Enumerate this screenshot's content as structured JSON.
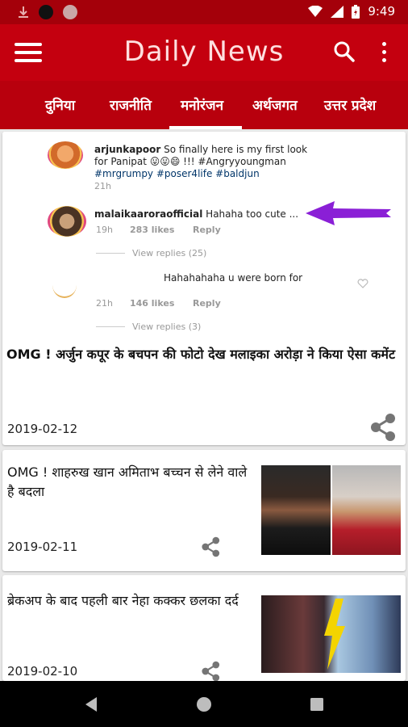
{
  "status": {
    "time": "9:49"
  },
  "app": {
    "title": "Daily News"
  },
  "tabs": [
    {
      "label": "दुनिया"
    },
    {
      "label": "राजनीति"
    },
    {
      "label": "मनोरंजन"
    },
    {
      "label": "अर्थजगत"
    },
    {
      "label": "उत्तर प्रदेश"
    }
  ],
  "active_tab": "मनोरंजन",
  "featured": {
    "comments": [
      {
        "user": "arjunkapoor",
        "text": "So finally here is my first look",
        "text2": "for Panipat 😛😛😄 !!! #Angryyoungman",
        "text3": "#mrgrumpy #poser4life #baldjun",
        "time": "21h"
      },
      {
        "user": "malaikaaroraofficial",
        "text": "Hahaha too cute ...",
        "time": "19h",
        "likes": "283 likes",
        "reply": "Reply",
        "view_replies": "View replies (25)"
      },
      {
        "text": "Hahahahaha u were born for",
        "time": "21h",
        "likes": "146 likes",
        "reply": "Reply",
        "view_replies": "View replies (3)"
      }
    ],
    "headline": "OMG ! अर्जुन कपूर के बचपन की फोटो देख मलाइका अरोड़ा ने किया ऐसा कमेंट",
    "date": "2019-02-12"
  },
  "articles": [
    {
      "headline": "OMG ! शाहरुख खान अमिताभ बच्चन से लेने वाले है बदला",
      "date": "2019-02-11"
    },
    {
      "headline": "ब्रेकअप के बाद पहली बार नेहा कक्कर छलका दर्द",
      "date": "2019-02-10"
    }
  ],
  "colors": {
    "status_bar": "#a4000a",
    "app_bar": "#c4000f",
    "tab_bar": "#b8000d",
    "arrow": "#8a1fd6"
  },
  "icons": [
    "menu-icon",
    "search-icon",
    "more-vert-icon",
    "share-icon",
    "back-icon",
    "home-icon",
    "recents-icon"
  ]
}
